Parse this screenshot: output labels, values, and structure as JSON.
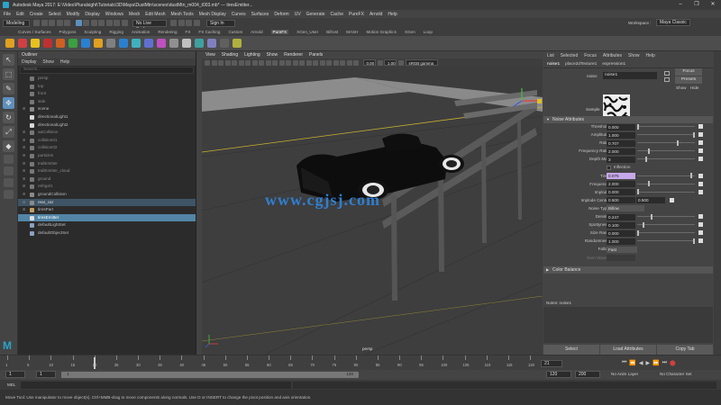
{
  "window": {
    "title": "Autodesk Maya 2017: E:\\Video\\Pluralsight\\Tutorials\\3D\\Maya\\DustMtn\\scenes\\dustMtn_m004_t003.mb* --- tiresEmitter...",
    "minimize": "–",
    "maximize": "❐",
    "close": "✕"
  },
  "menus": [
    "File",
    "Edit",
    "Create",
    "Select",
    "Modify",
    "Display",
    "Windows",
    "Mesh",
    "Edit Mesh",
    "Mesh Tools",
    "Mesh Display",
    "Curves",
    "Surfaces",
    "Deform",
    "UV",
    "Generate",
    "Cache",
    "PureFX",
    "Arnold",
    "Help"
  ],
  "status": {
    "mode": "Modeling",
    "no_live_surface": "No Live Surface",
    "sign_in": "Sign In",
    "workspace_label": "Workspace :",
    "workspace": "Maya Classic"
  },
  "shelf_tabs": [
    "Curves / Surfaces",
    "Polygons",
    "Sculpting",
    "Rigging",
    "Animation",
    "Rendering",
    "FX",
    "FX Caching",
    "Custom",
    "Arnold",
    "PureFX",
    "XGen_User",
    "Bifrost",
    "MASH",
    "Motion Graphics",
    "XGen",
    "Loop"
  ],
  "shelf_active": "PureFX",
  "shelf_icon_colors": [
    "#e0a020",
    "#d04040",
    "#e8c020",
    "#c03030",
    "#d06020",
    "#3aa040",
    "#2a80d0",
    "#e0a020",
    "#808080",
    "#2a80d0",
    "#40b0c0",
    "#6070d0",
    "#c050c0",
    "#909090",
    "#c0c0c0",
    "#40a0a0",
    "#8080c0",
    "#606060",
    "#b0b040"
  ],
  "tools": [
    "↖",
    "⬚",
    "✎",
    "✥",
    "↻",
    "⤢",
    "◆"
  ],
  "outliner": {
    "title": "Outliner",
    "menu": [
      "Display",
      "Show",
      "Help"
    ],
    "search_placeholder": "Search...",
    "items": [
      {
        "label": "persp",
        "state": "dim",
        "color": "#777"
      },
      {
        "label": "top",
        "state": "dim",
        "color": "#777"
      },
      {
        "label": "front",
        "state": "dim",
        "color": "#777"
      },
      {
        "label": "side",
        "state": "dim",
        "color": "#777"
      },
      {
        "label": "scene",
        "state": "",
        "color": "#8a8a8a"
      },
      {
        "label": "directionalLight1",
        "state": "",
        "color": "#d8d8d8"
      },
      {
        "label": "directionalLight2",
        "state": "",
        "color": "#d8d8d8"
      },
      {
        "label": "aaCollision",
        "state": "dim",
        "color": "#777"
      },
      {
        "label": "collision01",
        "state": "dim",
        "color": "#777"
      },
      {
        "label": "collision02",
        "state": "dim",
        "color": "#777"
      },
      {
        "label": "particles",
        "state": "dim",
        "color": "#777"
      },
      {
        "label": "trailEmitter",
        "state": "dim",
        "color": "#777"
      },
      {
        "label": "trailEmitter_cloud",
        "state": "dim",
        "color": "#777"
      },
      {
        "label": "ground",
        "state": "dim",
        "color": "#777"
      },
      {
        "label": "refrigel1",
        "state": "dim",
        "color": "#777"
      },
      {
        "label": "groundCollision",
        "state": "",
        "color": "#8a8a8a"
      },
      {
        "label": "rear_car",
        "state": "hl",
        "color": "#8a8a8a"
      },
      {
        "label": "tiresPart",
        "state": "",
        "color": "#c0a060"
      },
      {
        "label": "tiresEmitter",
        "state": "sel",
        "color": "#e0e0e0"
      },
      {
        "label": "defaultLightSet",
        "state": "",
        "color": "#8aa0c0"
      },
      {
        "label": "defaultObjectSet",
        "state": "",
        "color": "#8aa0c0"
      }
    ]
  },
  "viewport": {
    "menu": [
      "View",
      "Shading",
      "Lighting",
      "Show",
      "Renderer",
      "Panels"
    ],
    "exposure": "0.00",
    "gamma": "1.00",
    "colorspace": "sRGB gamma",
    "camera": "persp",
    "watermark": "www.cgjsj.com"
  },
  "attribute_editor": {
    "menu": [
      "List",
      "Selected",
      "Focus",
      "Attributes",
      "Show",
      "Help"
    ],
    "tabs": [
      "noise1",
      "place2dTexture1",
      "expression1"
    ],
    "noise_label": "noise:",
    "noise_value": "noise1",
    "focus_btn": "Focus",
    "presets_btn": "Presets",
    "show_btn": "Show",
    "hide_btn": "Hide",
    "sample_label": "Sample",
    "section": "Noise Attributes",
    "attributes": [
      {
        "label": "Threshold",
        "value": "0.000",
        "slider": 0.0
      },
      {
        "label": "Amplitude",
        "value": "1.000",
        "slider": 1.0
      },
      {
        "label": "Ratio",
        "value": "0.707",
        "slider": 0.707
      },
      {
        "label": "Frequency Ratio",
        "value": "2.000",
        "slider": 0.2
      },
      {
        "label": "Depth Max",
        "value": "3",
        "slider": 0.15
      }
    ],
    "inflection_label": "Inflection",
    "time_label": "Time",
    "time_value": "0.075",
    "time_slider": 0.95,
    "attributes2": [
      {
        "label": "Frequency",
        "value": "2.000",
        "slider": 0.2
      },
      {
        "label": "Implode",
        "value": "0.000",
        "slider": 0.0
      }
    ],
    "implode_center_label": "Implode Center",
    "implode_center_x": "0.500",
    "implode_center_y": "0.500",
    "noise_type_label": "Noise Type",
    "noise_type_value": "Billow",
    "attributes3": [
      {
        "label": "Density",
        "value": "0.247",
        "slider": 0.247
      },
      {
        "label": "Spottyness",
        "value": "0.100",
        "slider": 0.1
      },
      {
        "label": "Size Rand",
        "value": "0.000",
        "slider": 0.0
      },
      {
        "label": "Randomness",
        "value": "1.000",
        "slider": 1.0
      }
    ],
    "falloff_label": "Falloff",
    "falloff_value": "Fast",
    "num_waves_label": "Num Waves",
    "color_balance": "Color Balance",
    "notes_label": "Notes: noise1",
    "select_btn": "Select",
    "load_btn": "Load Attributes",
    "copy_btn": "Copy Tab"
  },
  "timeline": {
    "ticks": [
      "1",
      "5",
      "10",
      "15",
      "20",
      "25",
      "30",
      "35",
      "40",
      "45",
      "50",
      "55",
      "60",
      "65",
      "70",
      "75",
      "80",
      "85",
      "90",
      "95",
      "100",
      "105",
      "110",
      "115",
      "120"
    ],
    "current_frame": "21",
    "current_marker": 0.166
  },
  "range": {
    "start": "1",
    "start2": "1",
    "inner_start": "1",
    "inner_end": "120",
    "end": "120",
    "end2": "200",
    "anim_layer": "No Anim Layer",
    "char_set": "No Character Set"
  },
  "command": {
    "lang": "MEL"
  },
  "help_line": "Move Tool: Use manipulator to move object(s). Ctrl+MMB-drag to move components along normals. Use D or INSERT to change the pivot position and axis orientation."
}
